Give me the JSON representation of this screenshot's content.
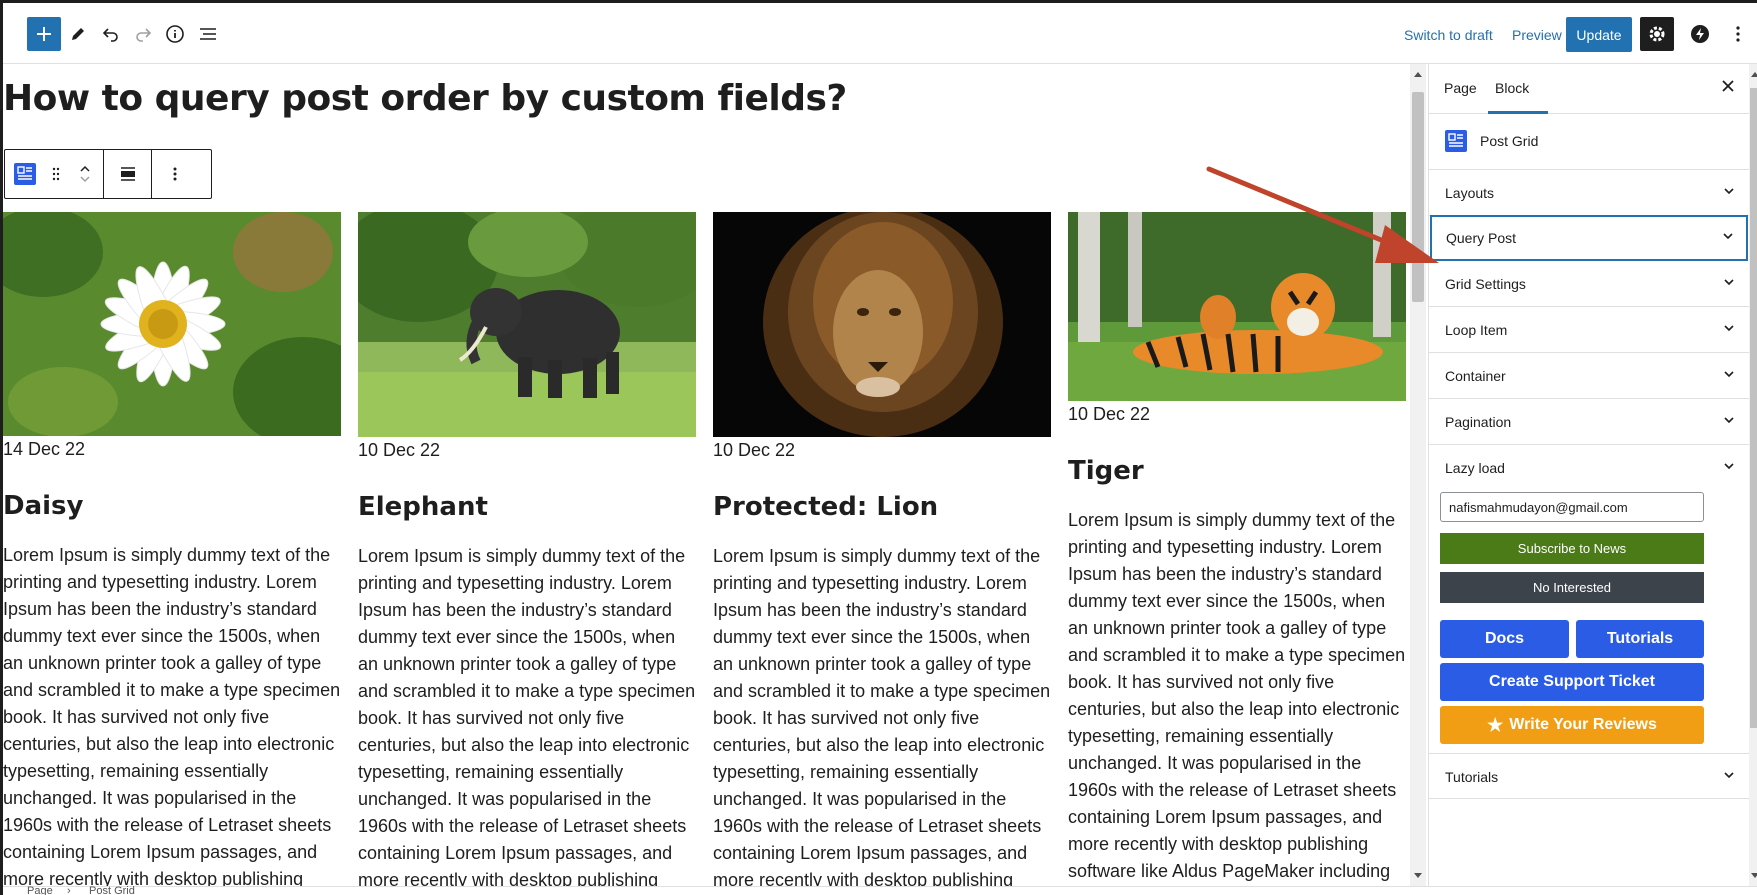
{
  "toolbar": {
    "switch_to_draft": "Switch to draft",
    "preview": "Preview",
    "update": "Update"
  },
  "post": {
    "title": "How to query post order by custom fields?"
  },
  "cards": [
    {
      "date": "14 Dec 22",
      "title": "Daisy",
      "excerpt": "Lorem Ipsum is simply dummy text of the printing and typesetting industry. Lorem Ipsum has been the industry’s standard dummy text ever since the 1500s, when an unknown printer took a galley of type and scrambled it to make a type specimen book. It has survived not only five centuries, but also the leap into electronic typesetting, remaining essentially unchanged. It was popularised in the 1960s with the release of Letraset sheets containing Lorem Ipsum passages, and more recently with desktop publishing"
    },
    {
      "date": "10 Dec 22",
      "title": "Elephant",
      "excerpt": "Lorem Ipsum is simply dummy text of the printing and typesetting industry. Lorem Ipsum has been the industry’s standard dummy text ever since the 1500s, when an unknown printer took a galley of type and scrambled it to make a type specimen book. It has survived not only five centuries, but also the leap into electronic typesetting, remaining essentially unchanged. It was popularised in the 1960s with the release of Letraset sheets containing Lorem Ipsum passages, and more recently with desktop publishing"
    },
    {
      "date": "10 Dec 22",
      "title": "Protected: Lion",
      "excerpt": "Lorem Ipsum is simply dummy text of the printing and typesetting industry. Lorem Ipsum has been the industry’s standard dummy text ever since the 1500s, when an unknown printer took a galley of type and scrambled it to make a type specimen book. It has survived not only five centuries, but also the leap into electronic typesetting, remaining essentially unchanged. It was popularised in the 1960s with the release of Letraset sheets containing Lorem Ipsum passages, and more recently with desktop publishing"
    },
    {
      "date": "10 Dec 22",
      "title": "Tiger",
      "excerpt": "Lorem Ipsum is simply dummy text of the printing and typesetting industry. Lorem Ipsum has been the industry’s standard dummy text ever since the 1500s, when an unknown printer took a galley of type and scrambled it to make a type specimen book. It has survived not only five centuries, but also the leap into electronic typesetting, remaining essentially unchanged. It was popularised in the 1960s with the release of Letraset sheets containing Lorem Ipsum passages, and more recently with desktop publishing software like Aldus PageMaker including"
    }
  ],
  "sidebar": {
    "tabs": [
      "Page",
      "Block"
    ],
    "active_tab": "Block",
    "block_name": "Post Grid",
    "panels": [
      "Layouts",
      "Query Post",
      "Grid Settings",
      "Loop Item",
      "Container",
      "Pagination",
      "Lazy load"
    ],
    "focused_panel": "Query Post",
    "email_value": "nafismahmudayon@gmail.com",
    "subscribe_label": "Subscribe to News",
    "no_interest_label": "No Interested",
    "docs_label": "Docs",
    "tutorials_label": "Tutorials",
    "support_label": "Create Support Ticket",
    "review_label": "Write Your Reviews",
    "bottom_panel": "Tutorials"
  },
  "footer": {
    "breadcrumb": [
      "Page",
      "Post Grid"
    ]
  },
  "colors": {
    "accent": "#2271b1",
    "subscribe": "#4b7b17",
    "no_interest": "#3c434a",
    "blue_button": "#2b5ce6",
    "review": "#f29e14",
    "annotation_arrow": "#c0432b"
  }
}
